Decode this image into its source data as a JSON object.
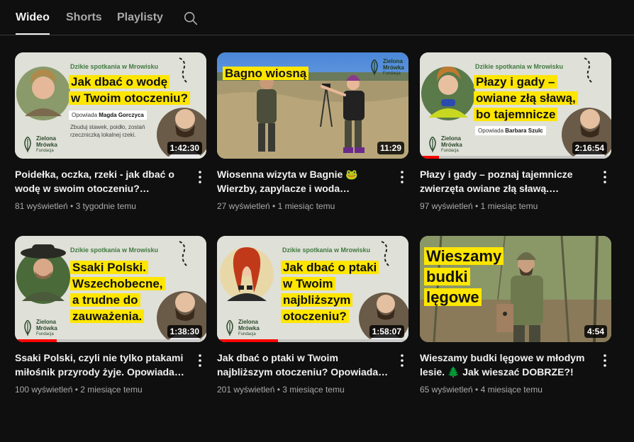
{
  "tabs": [
    "Wideo",
    "Shorts",
    "Playlisty"
  ],
  "active_tab": "Wideo",
  "series_label": "Dzikie spotkania w Mrowisku",
  "logo": {
    "line1": "Zielona",
    "line2": "Mrówka",
    "sub": "Fundacja"
  },
  "videos": [
    {
      "thumb_lines": [
        "Jak dbać o wodę",
        "w Twoim otoczeniu?"
      ],
      "narrator_prefix": "Opowiada",
      "narrator": "Magda Gorczyca",
      "small_text": "Zbuduj stawek, poidło, zostań rzeczniczką lokalnej rzeki.",
      "duration": "1:42:30",
      "title": "Poidełka, oczka, rzeki - jak dbać o wodę w swoim otoczeniu? Opowiada Magda Gorczyca",
      "views": "81 wyświetleń",
      "age": "3 tygodnie temu",
      "progress": 0
    },
    {
      "thumb_lines": [
        "Bagno wiosną"
      ],
      "duration": "11:29",
      "title": "Wiosenna wizyta w Bagnie 🐸 Wierzby, zapylacze i woda odpływająca rowem melioracyjnym",
      "views": "27 wyświetleń",
      "age": "1 miesiąc temu",
      "progress": 0
    },
    {
      "thumb_lines": [
        "Płazy i gady –",
        "owiane złą sławą,",
        "bo tajemnicze"
      ],
      "narrator_prefix": "Opowiada",
      "narrator": "Barbara Szulc",
      "duration": "2:16:54",
      "title": "Płazy i gady – poznaj tajemnicze zwierzęta owiane złą sławą. Opowiada Barbara Szulc",
      "views": "97 wyświetleń",
      "age": "1 miesiąc temu",
      "progress": 0.1
    },
    {
      "thumb_lines": [
        "Ssaki Polski.",
        "Wszechobecne,",
        "a trudne do",
        "zauważenia."
      ],
      "duration": "1:38:30",
      "title": "Ssaki Polski, czyli nie tylko ptakami miłośnik przyrody żyje. Opowiada Michał Skorb",
      "views": "100 wyświetleń",
      "age": "2 miesiące temu",
      "progress": 0.22
    },
    {
      "thumb_lines": [
        "Jak dbać o ptaki",
        "w Twoim",
        "najbliższym",
        "otoczeniu?"
      ],
      "duration": "1:58:07",
      "title": "Jak dbać o ptaki w Twoim najbliższym otoczeniu? Opowiada Karolina Skorb",
      "views": "201 wyświetleń",
      "age": "3 miesiące temu",
      "progress": 0.32
    },
    {
      "thumb_lines": [
        "Wieszamy",
        "budki",
        "lęgowe"
      ],
      "duration": "4:54",
      "title": "Wieszamy budki lęgowe w młodym lesie. 🌲 Jak wieszać DOBRZE?!",
      "views": "65 wyświetleń",
      "age": "4 miesiące temu",
      "progress": 0
    }
  ],
  "colors": {
    "accent_yellow": "#ffe600",
    "progress_red": "#ff0000",
    "background": "#0f0f0f"
  },
  "icons": {
    "search": "search-icon",
    "more": "more-vert-icon"
  }
}
